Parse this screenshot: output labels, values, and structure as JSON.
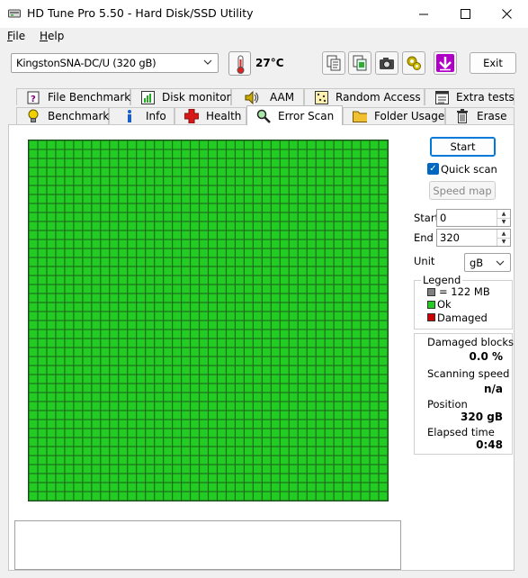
{
  "window": {
    "title": "HD Tune Pro 5.50 - Hard Disk/SSD Utility"
  },
  "menu": [
    {
      "label": "File",
      "accel": "F",
      "rest": "ile"
    },
    {
      "label": "Help",
      "accel": "H",
      "rest": "elp"
    }
  ],
  "toolbar": {
    "drive": "KingstonSNA-DC/U (320 gB)",
    "temperature": "27°C",
    "exit_label": "Exit",
    "icons": [
      "copy-text-icon",
      "copy-screenshot-icon",
      "camera-icon",
      "options-gear-icon",
      "save-down-arrow-icon"
    ]
  },
  "tabs_top": [
    {
      "label": "File Benchmark",
      "icon": "file-benchmark-icon"
    },
    {
      "label": "Disk monitor",
      "icon": "disk-monitor-icon"
    },
    {
      "label": "AAM",
      "icon": "speaker-icon"
    },
    {
      "label": "Random Access",
      "icon": "random-access-icon"
    },
    {
      "label": "Extra tests",
      "icon": "extra-tests-icon"
    }
  ],
  "tabs_bottom": [
    {
      "label": "Benchmark",
      "icon": "lightbulb-icon"
    },
    {
      "label": "Info",
      "icon": "info-icon"
    },
    {
      "label": "Health",
      "icon": "health-cross-icon"
    },
    {
      "label": "Error Scan",
      "icon": "magnifier-icon",
      "active": true
    },
    {
      "label": "Folder Usage",
      "icon": "folder-icon"
    },
    {
      "label": "Erase",
      "icon": "trash-icon"
    }
  ],
  "scan": {
    "start_label": "Start",
    "quick_scan_label": "Quick scan",
    "quick_scan_checked": true,
    "speed_map_label": "Speed map",
    "start_field_label": "Start",
    "start_value": "0",
    "end_field_label": "End",
    "end_value": "320",
    "unit_label": "Unit",
    "unit_value": "gB",
    "grid": {
      "cols": 40,
      "rows": 40,
      "status": "ok"
    }
  },
  "legend": {
    "title": "Legend",
    "block_size": "= 122 MB",
    "ok": "Ok",
    "damaged": "Damaged",
    "colors": {
      "block": "#808080",
      "ok": "#22cc22",
      "damaged": "#cc0000"
    }
  },
  "stats": {
    "damaged_label": "Damaged blocks",
    "damaged_value": "0.0 %",
    "speed_label": "Scanning speed",
    "speed_value": "n/a",
    "position_label": "Position",
    "position_value": "320 gB",
    "elapsed_label": "Elapsed time",
    "elapsed_value": "0:48"
  }
}
